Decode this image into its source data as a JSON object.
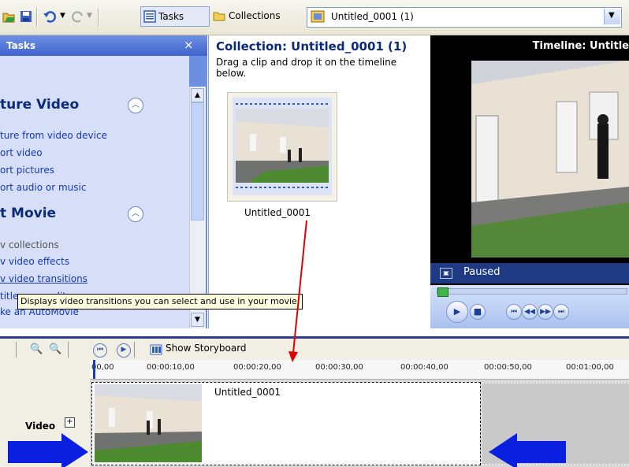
{
  "toolbar": {
    "tasks_label": "Tasks",
    "collections_label": "Collections",
    "collection_selected": "Untitled_0001 (1)"
  },
  "tasks_pane": {
    "header": "Tasks",
    "close_glyph": "×",
    "sections": [
      {
        "title": "Capture Video",
        "links": [
          "Capture from video device",
          "Import video",
          "Import pictures",
          "Import audio or music"
        ]
      },
      {
        "title": "Edit Movie",
        "links": [
          "Show collections",
          "View video effects",
          "View video transitions",
          "Make titles or credits",
          "Make an AutoMovie"
        ]
      }
    ],
    "visible_text": {
      "capture_title": "ture Video",
      "capture_links": [
        "ture from video device",
        "ort video",
        "ort pictures",
        "ort audio or music"
      ],
      "edit_title": "t Movie",
      "edit_links": [
        "v collections",
        "v video effects",
        "v video transitions",
        "titles or credits",
        "ke an AutoMovie"
      ],
      "header": "Tasks"
    }
  },
  "tooltip": "Displays video transitions you can select and use in your movie.",
  "collection_pane": {
    "title": "Collection: Untitled_0001 (1)",
    "hint": "Drag a clip and drop it on the timeline below.",
    "clip_name": "Untitled_0001"
  },
  "preview_pane": {
    "title": "Timeline: Untitle",
    "status": "Paused"
  },
  "timeline_toolbar": {
    "storyboard_label": "Show Storyboard"
  },
  "ruler": {
    "ticks": [
      "00,00",
      "00:00:10,00",
      "00:00:20,00",
      "00:00:30,00",
      "00:00:40,00",
      "00:00:50,00",
      "00:01:00,00"
    ]
  },
  "track": {
    "label": "Video",
    "expand_glyph": "+",
    "clip_name": "Untitled_0001"
  },
  "colors": {
    "tasks_blue": "#6d8fe0",
    "annotation_arrow_red": "#e00000",
    "annotation_arrow_blue": "#0a1fe0"
  }
}
